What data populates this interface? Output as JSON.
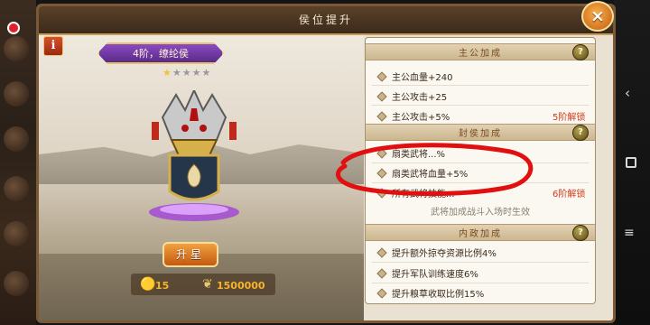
{
  "window": {
    "title": "侯位提升"
  },
  "info_label": "i",
  "close_label": "×",
  "rank": {
    "title": "4阶，缭纶侯",
    "stars_filled": 1,
    "stars_total": 5
  },
  "upgrade_button": "升星",
  "resources": {
    "gold_value": "15",
    "grain_value": "1500000"
  },
  "sections": [
    {
      "title": "主公加成",
      "help": "?",
      "rows": [
        {
          "text": "主公血量+240",
          "lock": ""
        },
        {
          "text": "主公攻击+25",
          "lock": ""
        },
        {
          "text": "主公攻击+5%",
          "lock": "5阶解锁"
        }
      ]
    },
    {
      "title": "封侯加成",
      "help": "?",
      "rows": [
        {
          "text": "扇类武将...%",
          "lock": ""
        },
        {
          "text": "扇类武将血量+5%",
          "lock": ""
        },
        {
          "text": "所有武将技能...",
          "lock": "6阶解锁"
        }
      ],
      "note": "武将加成战斗入场时生效"
    },
    {
      "title": "内政加成",
      "help": "?",
      "rows": [
        {
          "text": "提升额外掠夺资源比例4%",
          "lock": ""
        },
        {
          "text": "提升军队训练速度6%",
          "lock": ""
        },
        {
          "text": "提升粮草收取比例15%",
          "lock": ""
        }
      ]
    }
  ],
  "colors": {
    "accent": "#c45a10",
    "lock": "#d43a1a",
    "annotation": "#e01010"
  },
  "icons": [
    "gold-ingot-icon",
    "grain-icon",
    "help-icon",
    "close-icon",
    "info-icon"
  ]
}
